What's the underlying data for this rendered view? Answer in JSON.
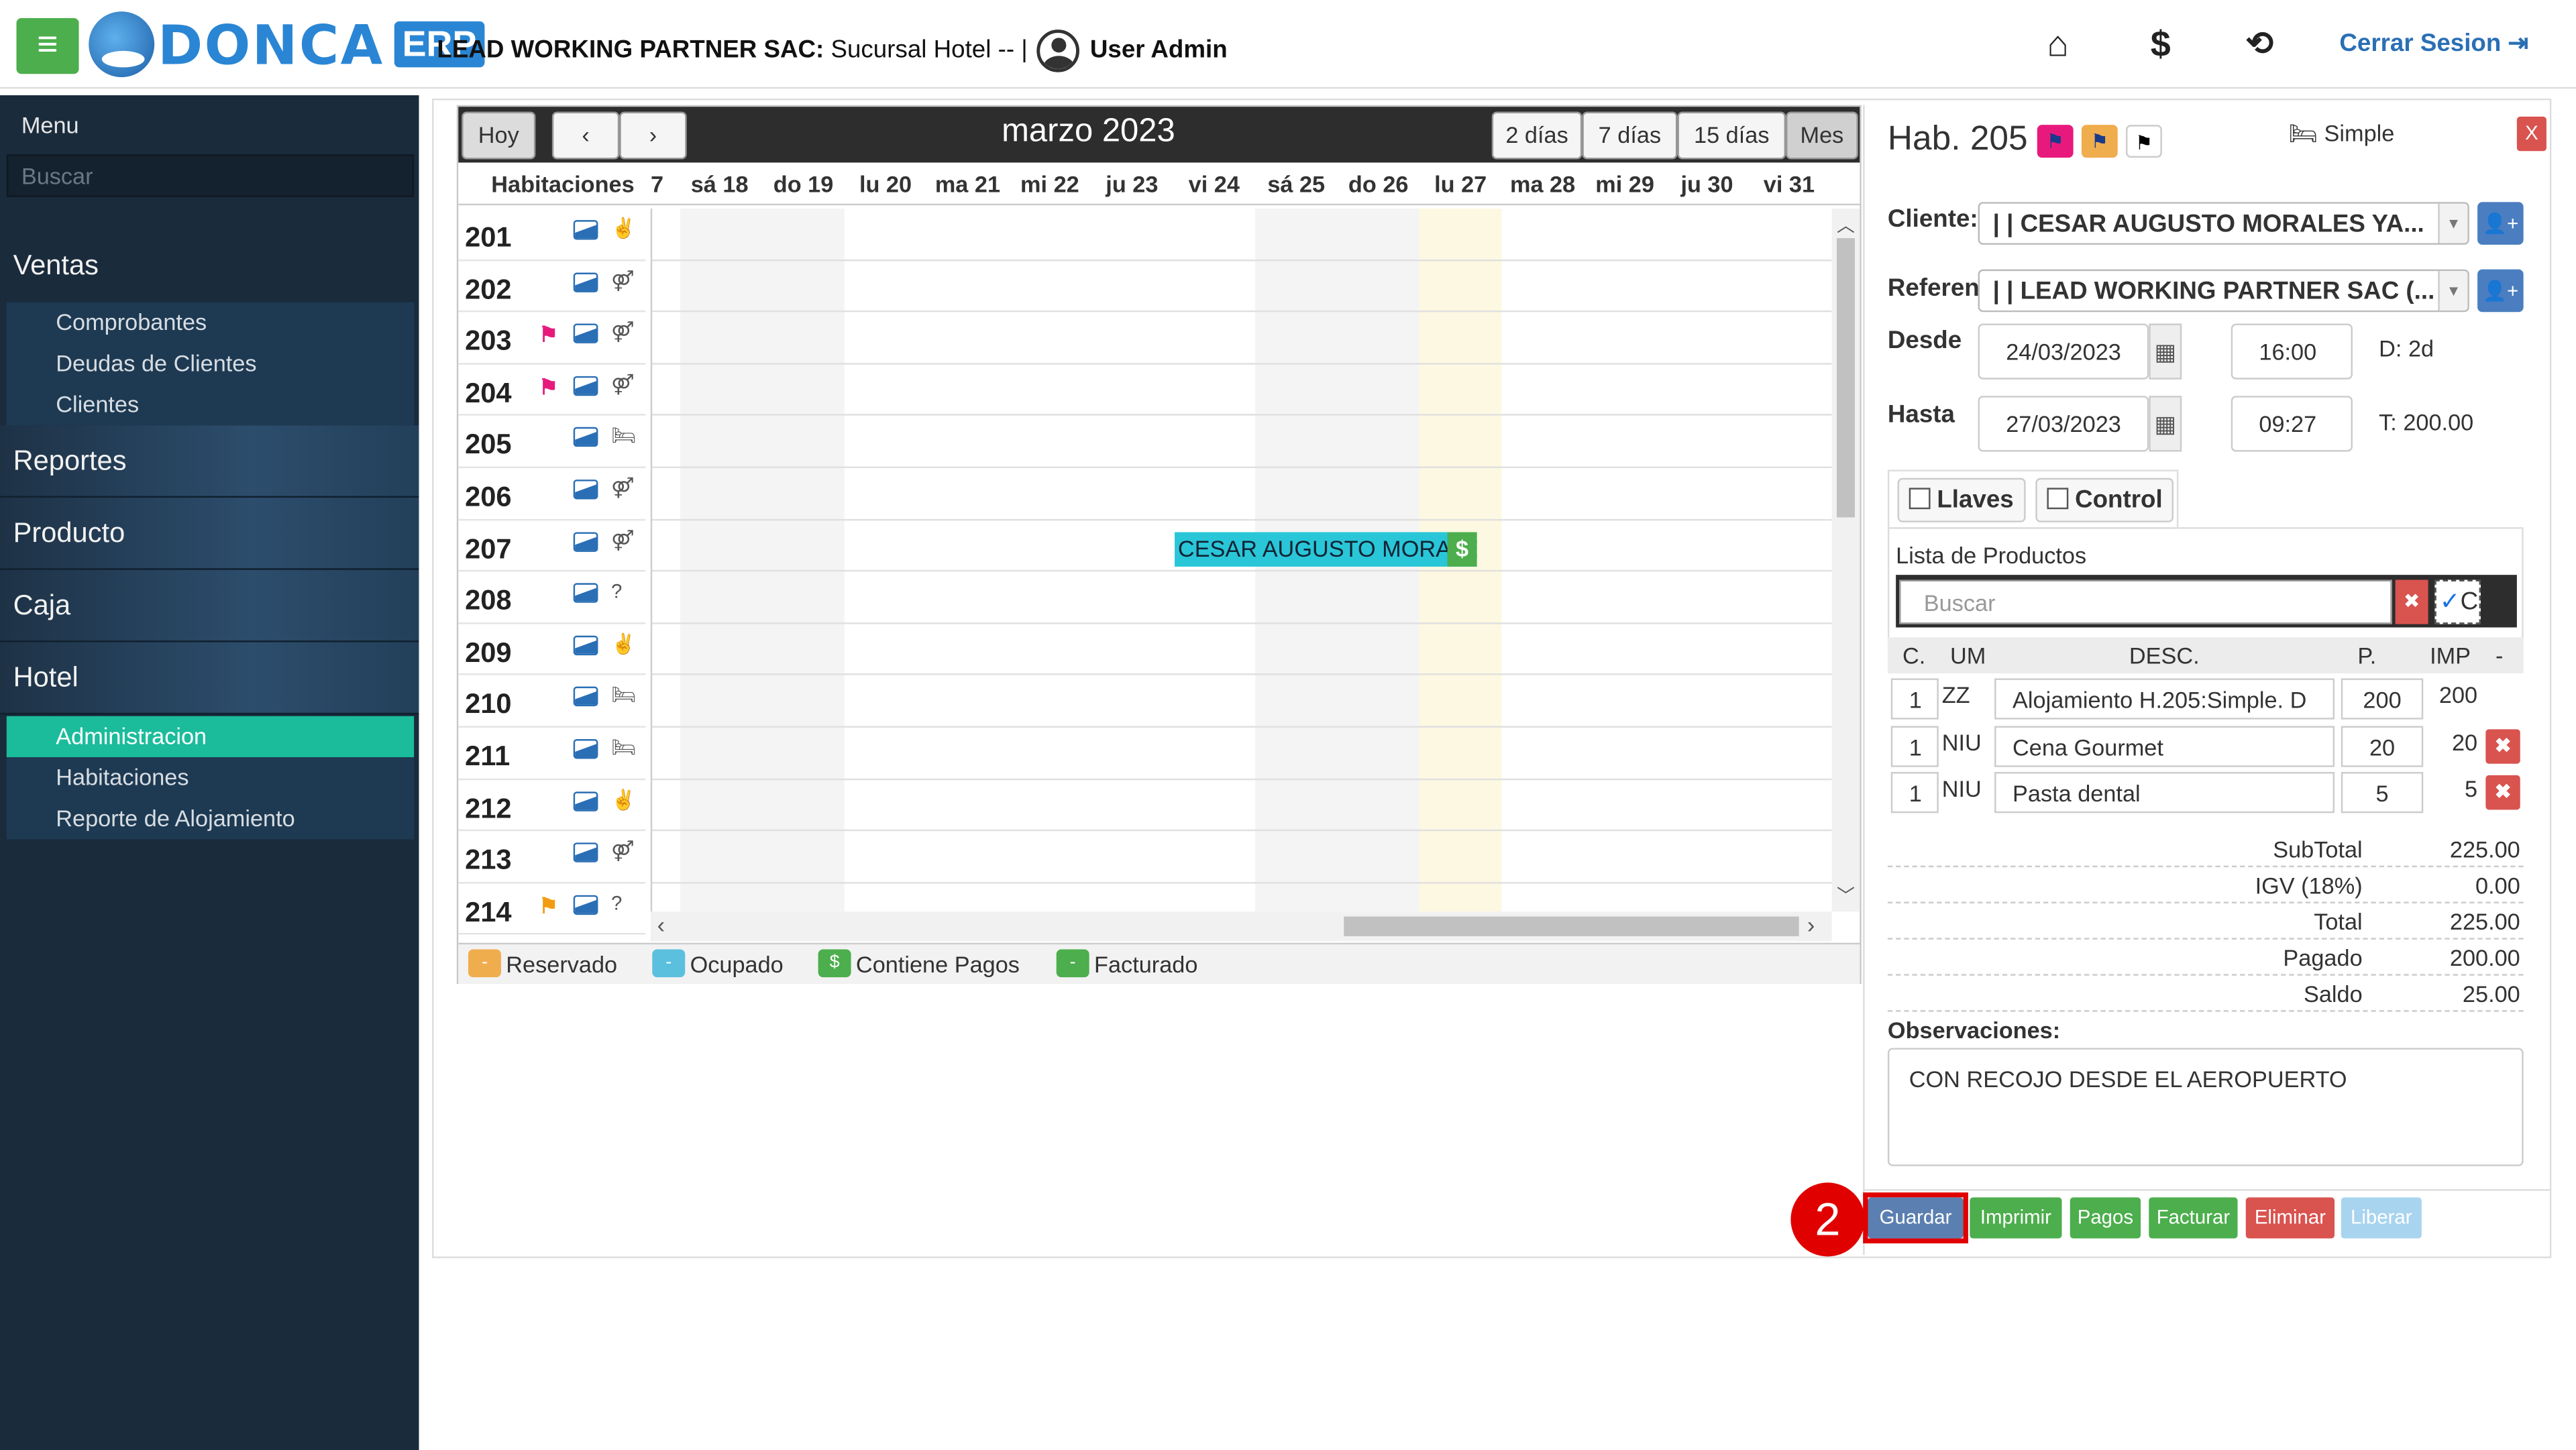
{
  "header": {
    "logo_text": "DONCA",
    "logo_badge": "ERP",
    "company_bold": "LEAD WORKING PARTNER SAC:",
    "company_rest": "Sucursal Hotel -- |",
    "user": "User Admin",
    "logout": "Cerrar Sesion"
  },
  "sidebar": {
    "menu_label": "Menu",
    "search_placeholder": "Buscar",
    "sections": {
      "ventas": "Ventas",
      "reportes": "Reportes",
      "producto": "Producto",
      "caja": "Caja",
      "hotel": "Hotel"
    },
    "ventas_items": [
      "Comprobantes",
      "Deudas de Clientes",
      "Clientes"
    ],
    "hotel_items": [
      "Administracion",
      "Habitaciones",
      "Reporte de Alojamiento"
    ]
  },
  "calendar": {
    "today": "Hoy",
    "title": "marzo 2023",
    "views": [
      "2 días",
      "7 días",
      "15 días",
      "Mes"
    ],
    "rooms_header": "Habitaciones",
    "days": [
      "7",
      "sá 18",
      "do 19",
      "lu 20",
      "ma 21",
      "mi 22",
      "ju 23",
      "vi 24",
      "sá 25",
      "do 26",
      "lu 27",
      "ma 28",
      "mi 29",
      "ju 30",
      "vi 31"
    ],
    "rooms": [
      {
        "num": "201",
        "icon": "✌"
      },
      {
        "num": "202",
        "icon": "⚤"
      },
      {
        "num": "203",
        "icon": "⚤",
        "flag": "#e8197d"
      },
      {
        "num": "204",
        "icon": "⚤",
        "flag": "#e8197d"
      },
      {
        "num": "205",
        "icon": "🛏"
      },
      {
        "num": "206",
        "icon": "⚤"
      },
      {
        "num": "207",
        "icon": "⚤"
      },
      {
        "num": "208",
        "icon": "?"
      },
      {
        "num": "209",
        "icon": "✌"
      },
      {
        "num": "210",
        "icon": "🛏"
      },
      {
        "num": "211",
        "icon": "🛏"
      },
      {
        "num": "212",
        "icon": "✌"
      },
      {
        "num": "213",
        "icon": "⚤"
      },
      {
        "num": "214",
        "icon": "?",
        "flag": "#f39c12"
      }
    ],
    "event": {
      "text": "CESAR AUGUSTO MORALES YALTA",
      "pay_symbol": "$"
    },
    "legend": [
      {
        "label": "Reservado",
        "color": "#f0ad4e",
        "mark": "-"
      },
      {
        "label": "Ocupado",
        "color": "#5bc0de",
        "mark": "-"
      },
      {
        "label": "Contiene Pagos",
        "color": "#4cae4c",
        "mark": "$"
      },
      {
        "label": "Facturado",
        "color": "#4cae4c",
        "mark": "-"
      }
    ]
  },
  "panel": {
    "title": "Hab. 205",
    "room_type": "Simple",
    "close": "X",
    "cliente_label": "Cliente:",
    "cliente_value": "| | CESAR AUGUSTO MORALES YA...",
    "referencia_label": "Referen",
    "referencia_value": "| | LEAD WORKING PARTNER SAC (...",
    "desde_label": "Desde",
    "desde_date": "24/03/2023",
    "desde_time": "16:00",
    "dias": "D: 2d",
    "hasta_label": "Hasta",
    "hasta_date": "27/03/2023",
    "hasta_time": "09:27",
    "total_short": "T: 200.00",
    "llaves": "Llaves",
    "control": "Control",
    "products_title": "Lista de Productos",
    "products_search_placeholder": "Buscar",
    "products_toggle": "C",
    "table_headers": {
      "c": "C.",
      "um": "UM",
      "desc": "DESC.",
      "p": "P.",
      "imp": "IMP",
      "minus": "-"
    },
    "products": [
      {
        "c": "1",
        "um": "ZZ",
        "desc": "Alojamiento H.205:Simple. D",
        "p": "200",
        "imp": "200"
      },
      {
        "c": "1",
        "um": "NIU",
        "desc": "Cena Gourmet",
        "p": "20",
        "imp": "20"
      },
      {
        "c": "1",
        "um": "NIU",
        "desc": "Pasta dental",
        "p": "5",
        "imp": "5"
      }
    ],
    "totals": [
      {
        "label": "SubTotal",
        "value": "225.00"
      },
      {
        "label": "IGV (18%)",
        "value": "0.00"
      },
      {
        "label": "Total",
        "value": "225.00"
      },
      {
        "label": "Pagado",
        "value": "200.00"
      },
      {
        "label": "Saldo",
        "value": "25.00"
      }
    ],
    "obs_label": "Observaciones:",
    "obs_value": "CON RECOJO DESDE EL AEROPUERTO",
    "actions": {
      "guardar": "Guardar",
      "imprimir": "Imprimir",
      "pagos": "Pagos",
      "facturar": "Facturar",
      "eliminar": "Eliminar",
      "liberar": "Liberar"
    },
    "step_badge": "2"
  }
}
